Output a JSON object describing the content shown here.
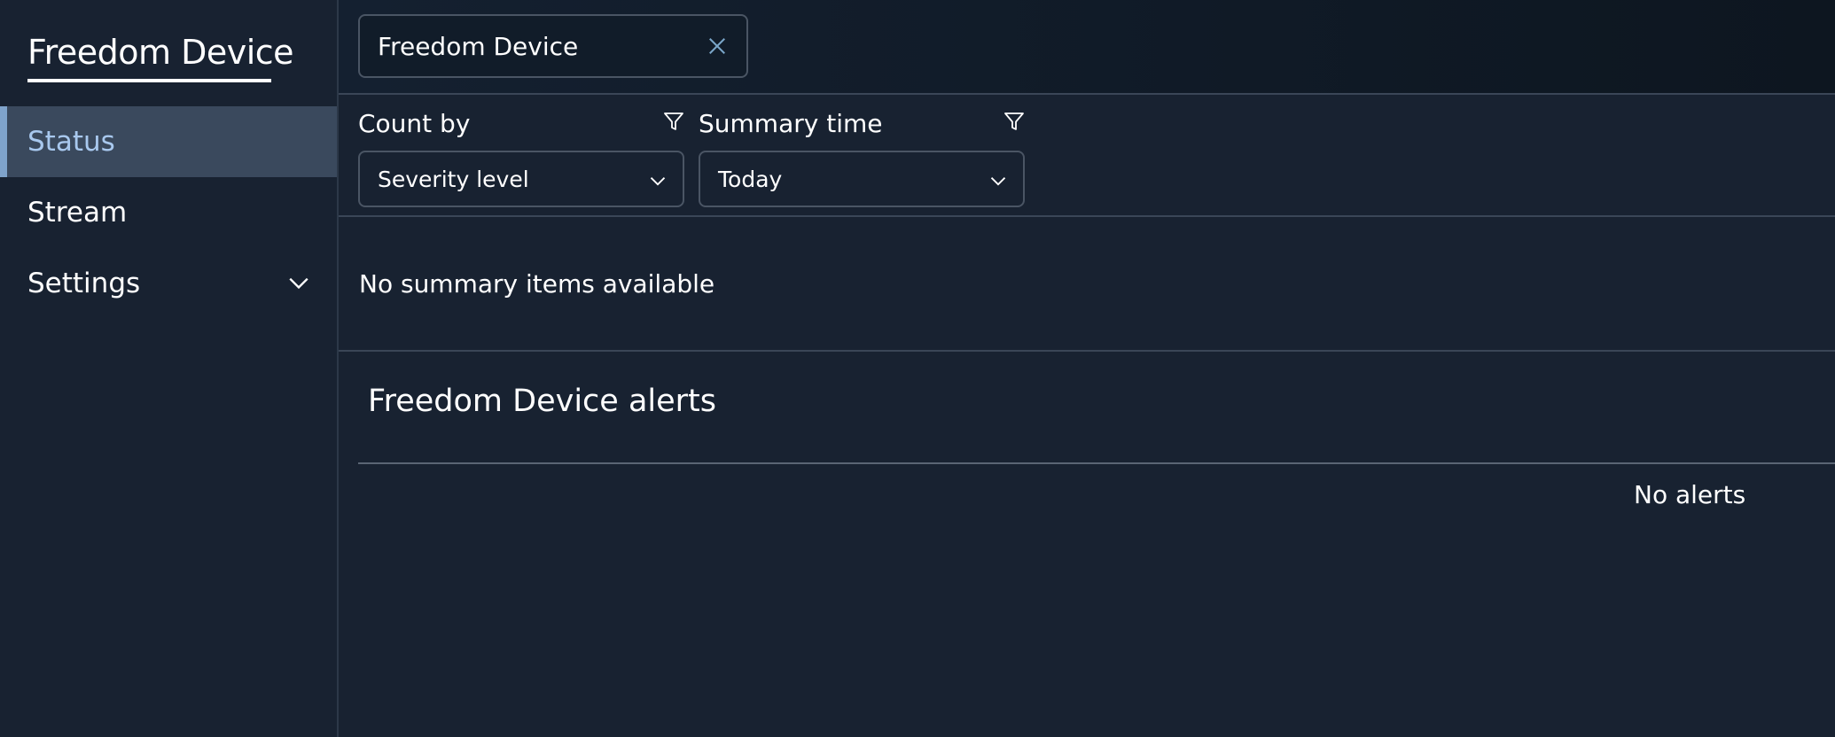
{
  "sidebar": {
    "brand": "Freedom Device",
    "items": [
      {
        "label": "Status",
        "active": true
      },
      {
        "label": "Stream",
        "active": false
      },
      {
        "label": "Settings",
        "active": false,
        "expandable": true
      }
    ]
  },
  "header": {
    "tab": {
      "label": "Freedom Device",
      "close_icon": "close-icon"
    }
  },
  "filters": {
    "count_by": {
      "label": "Count by",
      "value": "Severity level",
      "icon": "filter-icon"
    },
    "summary_time": {
      "label": "Summary time",
      "value": "Today",
      "icon": "filter-icon"
    }
  },
  "summary": {
    "empty_text": "No summary items available"
  },
  "alerts": {
    "title": "Freedom Device alerts",
    "empty_text": "No alerts"
  },
  "colors": {
    "background": "#182231",
    "active_nav_bg": "#3a495d",
    "active_nav_text": "#a8c8ee",
    "accent_bar": "#7fa3cb",
    "close_icon": "#7aa6c8"
  }
}
